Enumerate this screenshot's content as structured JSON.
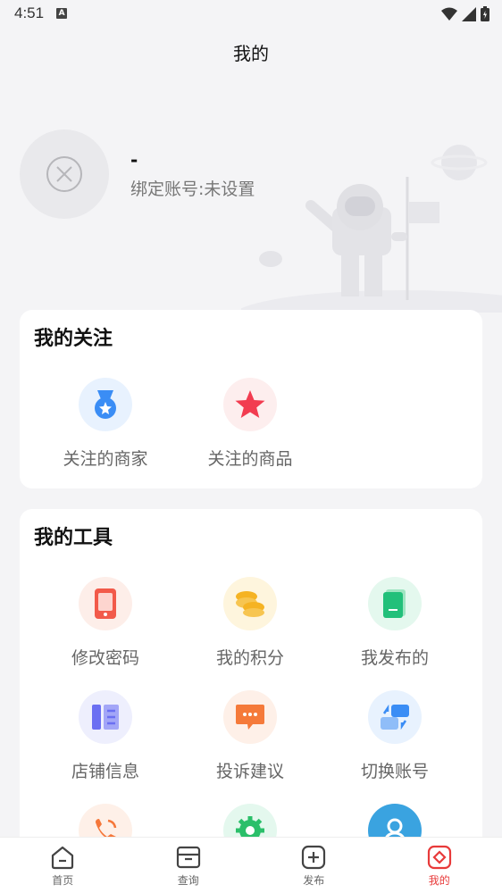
{
  "status": {
    "time": "4:51"
  },
  "page": {
    "title": "我的"
  },
  "profile": {
    "name": "-",
    "bind_text": "绑定账号:未设置"
  },
  "follow": {
    "title": "我的关注",
    "items": [
      {
        "label": "关注的商家",
        "icon": "medal-icon",
        "color": "#3a8df5"
      },
      {
        "label": "关注的商品",
        "icon": "star-icon",
        "color": "#f23c50"
      }
    ]
  },
  "tools": {
    "title": "我的工具",
    "items": [
      {
        "label": "修改密码",
        "icon": "phone-lock-icon",
        "color": "#f25a4a"
      },
      {
        "label": "我的积分",
        "icon": "coins-icon",
        "color": "#f5b323"
      },
      {
        "label": "我发布的",
        "icon": "book-icon",
        "color": "#22c07a"
      },
      {
        "label": "店铺信息",
        "icon": "store-info-icon",
        "color": "#6b6ff2"
      },
      {
        "label": "投诉建议",
        "icon": "message-icon",
        "color": "#f57a3a"
      },
      {
        "label": "切换账号",
        "icon": "switch-icon",
        "color": "#3a8df5"
      },
      {
        "label": "",
        "icon": "phone-call-icon",
        "color": "#f5773a"
      },
      {
        "label": "",
        "icon": "settings-icon",
        "color": "#2bbf6a"
      },
      {
        "label": "",
        "icon": "user-icon",
        "color": "#3aa3e0"
      }
    ]
  },
  "tabbar": {
    "items": [
      {
        "label": "首页",
        "icon": "home-icon"
      },
      {
        "label": "查询",
        "icon": "box-icon"
      },
      {
        "label": "发布",
        "icon": "plus-icon"
      },
      {
        "label": "我的",
        "icon": "profile-tab-icon",
        "active": true
      }
    ],
    "active_color": "#e83a3a"
  }
}
